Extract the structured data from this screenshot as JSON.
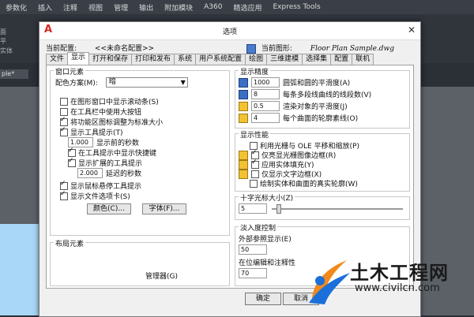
{
  "app": {
    "menu": [
      "参数化",
      "插入",
      "注释",
      "视图",
      "管理",
      "输出",
      "附加模块",
      "A360",
      "精选应用",
      "Express Tools"
    ],
    "left_labels": [
      "面",
      "平",
      "实体"
    ],
    "file_tab": "ple*"
  },
  "dialog": {
    "title": "选项",
    "current_config_label": "当前配置:",
    "current_config_value": "<<未命名配置>>",
    "current_drawing_label": "当前图形:",
    "current_drawing_value": "Floor Plan Sample.dwg",
    "tabs": [
      "文件",
      "显示",
      "打开和保存",
      "打印和发布",
      "系统",
      "用户系统配置",
      "绘图",
      "三维建模",
      "选择集",
      "配置",
      "联机"
    ],
    "active_tab": 1
  },
  "window_elements": {
    "title": "窗口元素",
    "color_scheme_label": "配色方案(M):",
    "color_scheme_value": "暗",
    "checks": [
      {
        "label": "在图形窗口中显示滚动条(S)",
        "checked": false
      },
      {
        "label": "在工具栏中使用大按钮",
        "checked": false
      },
      {
        "label": "将功能区图标调整为标准大小",
        "checked": true
      },
      {
        "label": "显示工具提示(T)",
        "checked": true
      }
    ],
    "delay_value": "1.000",
    "delay_label": "显示前的秒数",
    "shortcut_label": "在工具提示中显示快捷键",
    "shortcut_checked": true,
    "extended_label": "显示扩展的工具提示",
    "extended_checked": true,
    "extended_delay_value": "2.000",
    "extended_delay_label": "延迟的秒数",
    "rollover_label": "显示鼠标悬停工具提示",
    "rollover_checked": true,
    "file_tabs_label": "显示文件选项卡(S)",
    "file_tabs_checked": true,
    "colors_button": "颜色(C)...",
    "fonts_button": "字体(F)..."
  },
  "layout_elements": {
    "title": "布局元素",
    "partial_label": "管理器(G)"
  },
  "display_resolution": {
    "title": "显示精度",
    "items": [
      {
        "value": "1000",
        "label": "圆弧和圆的平滑度(A)"
      },
      {
        "value": "8",
        "label": "每条多段线曲线的线段数(V)"
      },
      {
        "value": "0.5",
        "label": "渲染对象的平滑度(J)"
      },
      {
        "value": "4",
        "label": "每个曲面的轮廓素线(O)"
      }
    ]
  },
  "display_performance": {
    "title": "显示性能",
    "items": [
      {
        "label": "利用光栅与 OLE 平移和缩放(P)",
        "checked": false
      },
      {
        "label": "仅亮显光栅图像边框(R)",
        "checked": true
      },
      {
        "label": "应用实体填充(Y)",
        "checked": true
      },
      {
        "label": "仅显示文字边框(X)",
        "checked": false
      },
      {
        "label": "绘制实体和曲面的真实轮廓(W)",
        "checked": false
      }
    ]
  },
  "crosshair": {
    "title": "十字光标大小(Z)",
    "value": "5"
  },
  "fade": {
    "title": "淡入度控制",
    "xref_label": "外部参照显示(E)",
    "xref_value": "50",
    "inplace_label": "在位编辑和注释性",
    "inplace_value": "70"
  },
  "buttons": {
    "ok": "确定",
    "cancel": "取消"
  },
  "watermark": {
    "title": "土木工程网",
    "url": "www.civilcn.com"
  },
  "colors": {
    "accent_red": "#d42a1e",
    "watermark_blue": "#1b6fd8",
    "watermark_orange": "#f08a1c"
  }
}
